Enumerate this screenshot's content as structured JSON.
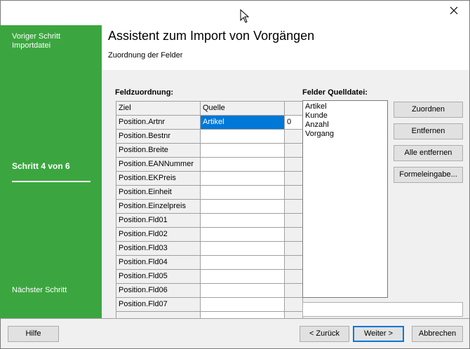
{
  "window": {
    "close_icon": "close-icon",
    "cursor_icon": "mouse-cursor-icon"
  },
  "sidebar": {
    "prev_line1": "Voriger Schritt",
    "prev_line2": "Importdatei",
    "step": "Schritt 4 von 6",
    "next": "Nächster Schritt",
    "bg_color": "#3ba63f"
  },
  "header": {
    "title": "Assistent zum Import von Vorgängen",
    "subtitle": "Zuordnung der Felder"
  },
  "mapping": {
    "label": "Feldzuordnung:",
    "col_ziel": "Ziel",
    "col_quelle": "Quelle",
    "rows": [
      {
        "ziel": "Position.Artnr",
        "quelle": "Artikel",
        "extra": "0"
      },
      {
        "ziel": "Position.Bestnr",
        "quelle": "",
        "extra": ""
      },
      {
        "ziel": "Position.Breite",
        "quelle": "",
        "extra": ""
      },
      {
        "ziel": "Position.EANNummer",
        "quelle": "",
        "extra": ""
      },
      {
        "ziel": "Position.EKPreis",
        "quelle": "",
        "extra": ""
      },
      {
        "ziel": "Position.Einheit",
        "quelle": "",
        "extra": ""
      },
      {
        "ziel": "Position.Einzelpreis",
        "quelle": "",
        "extra": ""
      },
      {
        "ziel": "Position.Fld01",
        "quelle": "",
        "extra": ""
      },
      {
        "ziel": "Position.Fld02",
        "quelle": "",
        "extra": ""
      },
      {
        "ziel": "Position.Fld03",
        "quelle": "",
        "extra": ""
      },
      {
        "ziel": "Position.Fld04",
        "quelle": "",
        "extra": ""
      },
      {
        "ziel": "Position.Fld05",
        "quelle": "",
        "extra": ""
      },
      {
        "ziel": "Position.Fld06",
        "quelle": "",
        "extra": ""
      },
      {
        "ziel": "Position.Fld07",
        "quelle": "",
        "extra": ""
      },
      {
        "ziel": "",
        "quelle": "",
        "extra": ""
      }
    ]
  },
  "source_fields": {
    "label": "Felder Quelldatei:",
    "items": [
      "Artikel",
      "Kunde",
      "Anzahl",
      "Vorgang"
    ],
    "input_value": ""
  },
  "actions": {
    "zuordnen": "Zuordnen",
    "entfernen": "Entfernen",
    "alle_entfernen": "Alle entfernen",
    "formeleingabe": "Formeleingabe..."
  },
  "footer": {
    "hilfe": "Hilfe",
    "zurueck": "< Zurück",
    "weiter": "Weiter >",
    "abbrechen": "Abbrechen"
  }
}
